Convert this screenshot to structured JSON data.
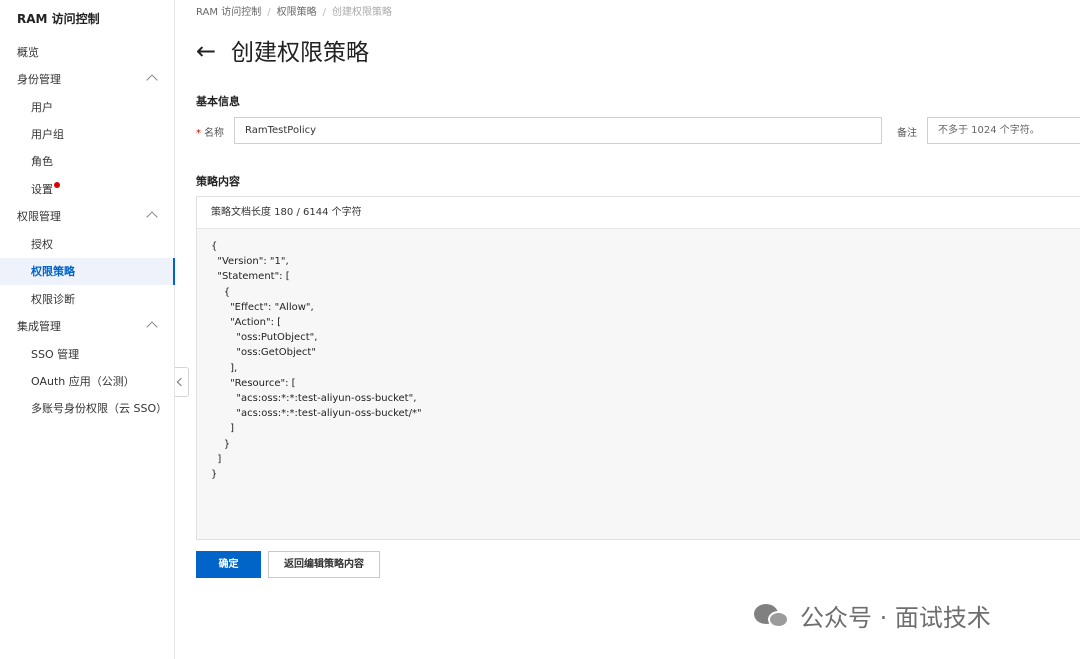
{
  "sidebar": {
    "title": "RAM 访问控制",
    "items": [
      {
        "label": "概览"
      },
      {
        "label": "身份管理"
      },
      {
        "label": "用户"
      },
      {
        "label": "用户组"
      },
      {
        "label": "角色"
      },
      {
        "label": "设置"
      },
      {
        "label": "权限管理"
      },
      {
        "label": "授权"
      },
      {
        "label": "权限策略"
      },
      {
        "label": "权限诊断"
      },
      {
        "label": "集成管理"
      },
      {
        "label": "SSO 管理"
      },
      {
        "label": "OAuth 应用（公测）"
      },
      {
        "label": "多账号身份权限（云 SSO）"
      }
    ]
  },
  "breadcrumb": {
    "items": [
      "RAM 访问控制",
      "权限策略",
      "创建权限策略"
    ]
  },
  "page": {
    "back_icon": "←",
    "title": "创建权限策略"
  },
  "basic_info": {
    "section_title": "基本信息",
    "name_label": "名称",
    "name_value": "RamTestPolicy",
    "remark_label": "备注",
    "remark_placeholder": "不多于 1024 个字符。"
  },
  "policy": {
    "section_title": "策略内容",
    "length_info": "策略文档长度 180 / 6144 个字符",
    "document": "{\n  \"Version\": \"1\",\n  \"Statement\": [\n    {\n      \"Effect\": \"Allow\",\n      \"Action\": [\n        \"oss:PutObject\",\n        \"oss:GetObject\"\n      ],\n      \"Resource\": [\n        \"acs:oss:*:*:test-aliyun-oss-bucket\",\n        \"acs:oss:*:*:test-aliyun-oss-bucket/*\"\n      ]\n    }\n  ]\n}"
  },
  "buttons": {
    "confirm": "确定",
    "back_edit": "返回编辑策略内容"
  },
  "watermark": {
    "text": "公众号 · 面试技术"
  },
  "colors": {
    "primary": "#0064c8",
    "required": "#dd0000"
  }
}
